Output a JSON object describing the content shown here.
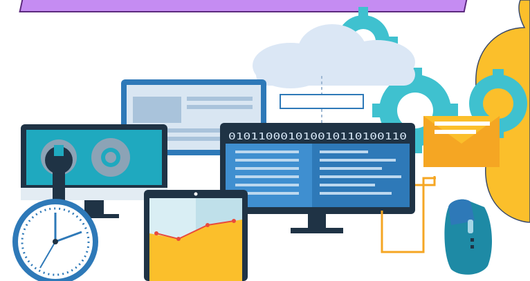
{
  "screens": {
    "code_monitor": {
      "binary_text": "010110001010010110100110"
    }
  },
  "palette": {
    "banner": "#c58cf2",
    "banner_border": "#5c2a7d",
    "cloud": "#dbe7f5",
    "gear": "#3fc1cf",
    "screen_blue": "#2e79b8",
    "monitor_dark": "#1f3345",
    "yellow": "#fbbf2b",
    "orange": "#f5a623",
    "tablet_red": "#e84a3c",
    "teal": "#1e8aa5"
  }
}
